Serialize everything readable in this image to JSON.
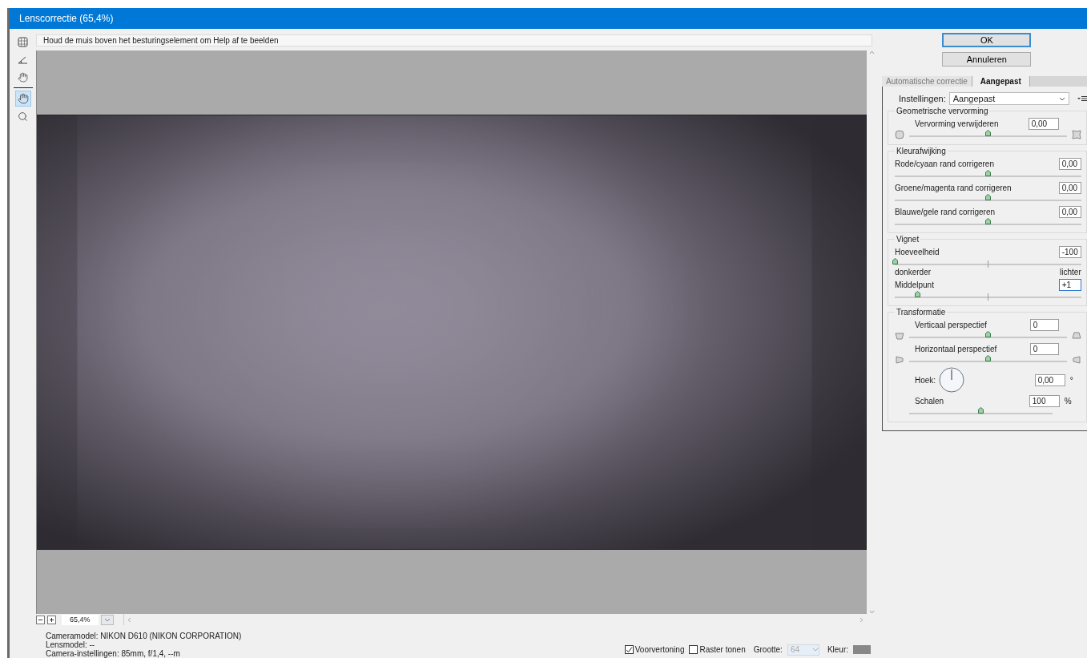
{
  "window": {
    "title": "Lenscorrectie (65,4%)"
  },
  "tools": [
    {
      "kind": "distortion",
      "selected": false
    },
    {
      "kind": "straighten",
      "selected": false
    },
    {
      "kind": "grid",
      "selected": false
    },
    {
      "kind": "hand",
      "selected": true
    },
    {
      "kind": "zoom",
      "selected": false
    }
  ],
  "help_text": "Houd de muis boven het besturingselement om Help af te beelden",
  "zoom": {
    "value": "65,4%"
  },
  "camera_info": [
    "Cameramodel: NIKON D610 (NIKON CORPORATION)",
    "Lensmodel: --",
    "Camera-instellingen: 85mm, f/1,4, --m"
  ],
  "preview_options": {
    "preview": {
      "label": "Voorvertoning",
      "checked": true
    },
    "grid": {
      "label": "Raster tonen",
      "checked": false
    },
    "size": {
      "label": "Grootte:",
      "value": "64",
      "disabled": true
    },
    "color": {
      "label": "Kleur:"
    }
  },
  "buttons": [
    {
      "label": "OK",
      "default": true
    },
    {
      "label": "Annuleren",
      "default": false
    }
  ],
  "tabs": [
    {
      "label": "Automatische correctie",
      "selected": false
    },
    {
      "label": "Aangepast",
      "selected": true
    }
  ],
  "settings": {
    "label": "Instellingen:",
    "value": "Aangepast"
  },
  "groups": [
    {
      "title": "Geometrische vervorming",
      "kind": "icons",
      "controls": [
        {
          "kind": "distortion-slider",
          "label": "Vervorming verwijderen",
          "value": "0,00",
          "level": 0.5
        }
      ]
    },
    {
      "title": "Kleurafwijking",
      "kind": "plain",
      "controls": [
        {
          "kind": "slider",
          "label": "Rode/cyaan rand corrigeren",
          "value": "0,00",
          "level": 0.5
        },
        {
          "kind": "slider",
          "label": "Groene/magenta rand corrigeren",
          "value": "0,00",
          "level": 0.5
        },
        {
          "kind": "slider",
          "label": "Blauwe/gele rand corrigeren",
          "value": "0,00",
          "level": 0.5
        }
      ]
    },
    {
      "title": "Vignet",
      "kind": "plain",
      "controls": [
        {
          "kind": "slider",
          "label": "Hoeveelheid",
          "value": "-100",
          "level": 0,
          "center_tick": true,
          "range_labels": [
            "donkerder",
            "lichter"
          ]
        },
        {
          "kind": "slider",
          "label": "Middelpunt",
          "value": "+1",
          "level": 0.12,
          "center_tick": true,
          "focused": true
        }
      ]
    },
    {
      "title": "Transformatie",
      "kind": "icons",
      "controls": [
        {
          "kind": "vertical-slider",
          "label": "Verticaal perspectief",
          "value": "0",
          "level": 0.5
        },
        {
          "kind": "horizontal-slider",
          "label": "Horizontaal perspectief",
          "value": "0",
          "level": 0.5
        },
        {
          "kind": "dial",
          "label": "Hoek:",
          "value": "0,00",
          "unit": "°"
        },
        {
          "kind": "slider",
          "label": "Schalen",
          "value": "100",
          "level": 0.5,
          "unit": "%"
        }
      ]
    }
  ]
}
